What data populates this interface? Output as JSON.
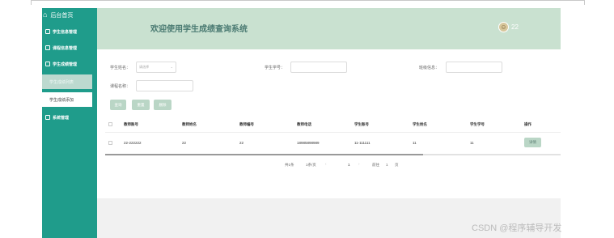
{
  "sidebar": {
    "home_label": "后台首页",
    "menus": [
      "学生信息管理",
      "课程信息管理",
      "学生成绩管理"
    ],
    "submenu": [
      "学生成绩列表",
      "学生成绩添加"
    ],
    "last_menu": "系统管理"
  },
  "header": {
    "title": "欢迎使用学生成绩查询系统",
    "user": "22"
  },
  "search": {
    "name_label": "学生姓名：",
    "name_placeholder": "请选择",
    "number_label": "学生学号：",
    "class_label": "班级信息：",
    "course_label": "课程名称："
  },
  "buttons": {
    "query": "查询",
    "reset": "重置",
    "delete": "删除"
  },
  "table": {
    "columns": [
      "教师账号",
      "教师姓名",
      "教师编号",
      "教师电话",
      "学生账号",
      "学生姓名",
      "学生学号",
      "操作"
    ],
    "rows": [
      {
        "cells": [
          "22-222222",
          "22",
          "22",
          "18985898989",
          "11-111111",
          "11",
          "11"
        ],
        "action": "详情"
      }
    ]
  },
  "pager": {
    "total": "共1条",
    "per_page": "1条/页",
    "prev": "‹",
    "page": "1",
    "next": "›",
    "goto": "前往",
    "goto_value": "1",
    "unit": "页"
  },
  "watermark": "CSDN @程序辅导开发"
}
